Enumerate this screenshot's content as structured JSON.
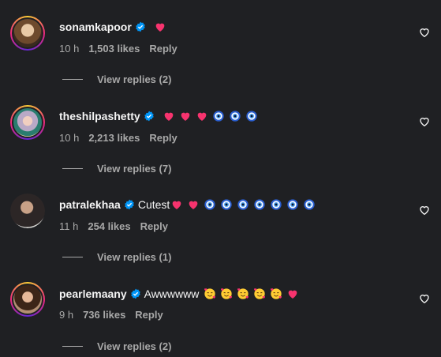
{
  "comments": [
    {
      "username": "sonamkapoor",
      "text": "",
      "emojis": [
        "heart"
      ],
      "time": "10 h",
      "likes": "1,503 likes",
      "reply_label": "Reply",
      "view_replies": "View replies (2)",
      "avatar_ring": true
    },
    {
      "username": "theshilpashetty",
      "text": "",
      "emojis": [
        "heart",
        "heart",
        "heart",
        "nazar",
        "nazar",
        "nazar"
      ],
      "time": "10 h",
      "likes": "2,213 likes",
      "reply_label": "Reply",
      "view_replies": "View replies (7)",
      "avatar_ring": true
    },
    {
      "username": "patralekhaa",
      "text": "Cutest",
      "emojis": [
        "heart",
        "heart",
        "nazar",
        "nazar",
        "nazar",
        "nazar",
        "nazar",
        "nazar",
        "nazar"
      ],
      "time": "11 h",
      "likes": "254 likes",
      "reply_label": "Reply",
      "view_replies": "View replies (1)",
      "avatar_ring": false
    },
    {
      "username": "pearlemaany",
      "text": "Awwwwww",
      "emojis": [
        "smiling-hearts",
        "smiling-hearts",
        "smiling-hearts",
        "smiling-hearts",
        "smiling-hearts",
        "heart"
      ],
      "time": "9 h",
      "likes": "736 likes",
      "reply_label": "Reply",
      "view_replies": "View replies (2)",
      "avatar_ring": true
    }
  ],
  "icons": {
    "verified": "verified-badge-icon",
    "like": "heart-outline-icon"
  },
  "colors": {
    "background": "#1f2023",
    "text": "#f5f5f5",
    "muted": "#a8a8a8",
    "verified": "#0095f6",
    "heart_emoji": "#f7336e"
  }
}
